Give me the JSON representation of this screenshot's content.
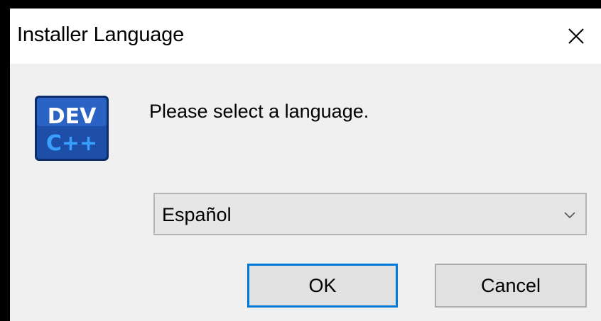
{
  "window": {
    "title": "Installer Language",
    "close_icon": "close-icon"
  },
  "app_icon": {
    "name": "devcpp-logo-icon",
    "line1": "DEV",
    "line2": "C++",
    "colors": {
      "background": "#1d4fa8",
      "text_top": "#ffffff",
      "text_bottom": "#3aa0ff"
    }
  },
  "prompt": {
    "text": "Please select a language."
  },
  "language_select": {
    "selected": "Español",
    "chevron_icon": "chevron-down-icon"
  },
  "buttons": {
    "ok_label": "OK",
    "cancel_label": "Cancel"
  },
  "colors": {
    "focus_border": "#0078d7",
    "dialog_bg": "#f0f0f0",
    "titlebar_bg": "#ffffff"
  }
}
